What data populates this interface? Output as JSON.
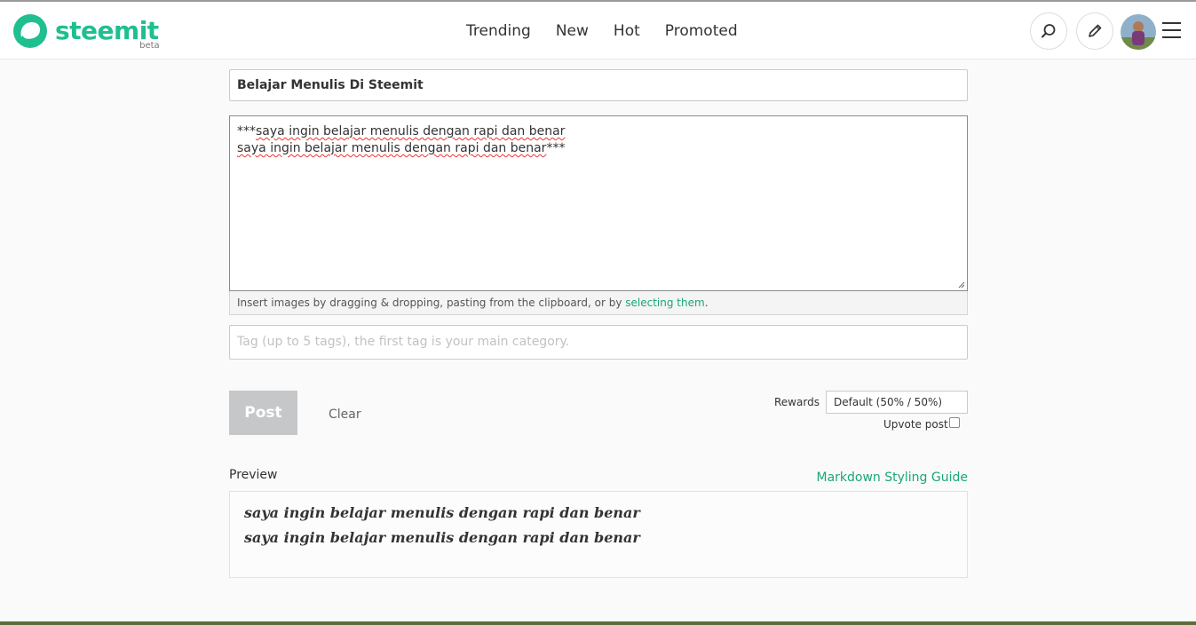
{
  "brand": {
    "name": "steemit",
    "badge": "beta",
    "color": "#1fbf8f"
  },
  "nav": {
    "items": [
      {
        "label": "Trending"
      },
      {
        "label": "New"
      },
      {
        "label": "Hot"
      },
      {
        "label": "Promoted"
      }
    ]
  },
  "header_actions": {
    "search_icon": "search-icon",
    "edit_icon": "pencil-icon",
    "menu_icon": "hamburger-icon"
  },
  "editor": {
    "title_value": "Belajar Menulis Di Steemit",
    "body_prefix": "***",
    "body_line1": "saya ingin belajar menulis dengan rapi dan benar",
    "body_line2": "saya ingin belajar menulis dengan rapi dan benar",
    "body_suffix": "***",
    "drop_hint_text": "Insert images by dragging & dropping, pasting from the clipboard, or by ",
    "drop_hint_link": "selecting them",
    "drop_hint_end": ".",
    "tag_placeholder": "Tag (up to 5 tags), the first tag is your main category."
  },
  "actions": {
    "post_label": "Post",
    "clear_label": "Clear",
    "rewards_label": "Rewards",
    "rewards_value": "Default (50% / 50%)",
    "upvote_label": "Upvote post",
    "upvote_checked": false
  },
  "preview": {
    "label": "Preview",
    "guide_link": "Markdown Styling Guide",
    "lines": [
      "saya ingin belajar menulis dengan rapi dan benar",
      "saya ingin belajar menulis dengan rapi dan benar"
    ]
  },
  "colors": {
    "accent": "#1aa676",
    "post_disabled": "#c5c7c9"
  }
}
